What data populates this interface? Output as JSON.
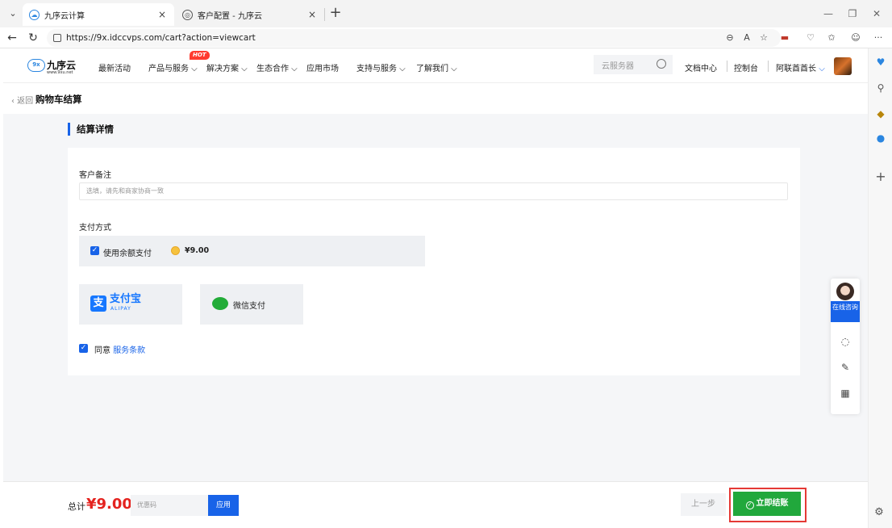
{
  "browser": {
    "tabs": [
      {
        "title": "九序云计算",
        "active": true
      },
      {
        "title": "客户配置 - 九序云",
        "active": false
      }
    ],
    "url": "https://9x.idccvps.com/cart?action=viewcart",
    "new_tab_symbol": "+",
    "close_symbol": "×"
  },
  "site": {
    "logo": {
      "mark": "9x",
      "name": "九序云",
      "sub": "www.9xu.net"
    },
    "nav": [
      {
        "label": "最新活动"
      },
      {
        "label": "产品与服务 ⌵"
      },
      {
        "label": "解决方案 ⌵"
      },
      {
        "label": "生态合作 ⌵"
      },
      {
        "label": "应用市场"
      },
      {
        "label": "支持与服务 ⌵"
      },
      {
        "label": "了解我们 ⌵"
      }
    ],
    "hot_badge": "HOT",
    "search_placeholder": "云服务器",
    "doc_center": "文档中心",
    "console": "控制台",
    "user_name": "阿联酋酋长"
  },
  "crumb": {
    "back": "‹ 返回",
    "title": "购物车结算"
  },
  "section_title": "结算详情",
  "form": {
    "note_label": "客户备注",
    "note_placeholder": "选填，请先和商家协商一致",
    "pay_method_label": "支付方式",
    "use_balance_label": "使用余额支付",
    "balance_amount": "¥9.00",
    "alipay": {
      "glyph": "支",
      "name": "支付宝",
      "sub": "ALIPAY"
    },
    "wechat": {
      "name": "微信支付"
    },
    "agree_text": "同意",
    "terms_text": "服务条款"
  },
  "service_widget": {
    "consult": "在线咨询"
  },
  "footer": {
    "total_label": "总计",
    "total_amount": "¥9.00",
    "coupon_placeholder": "优惠码",
    "apply_button": "应用",
    "prev_button": "上一步",
    "pay_button": "立即结账"
  },
  "colors": {
    "accent_blue": "#1863e8",
    "price_red": "#e4231f",
    "pay_green": "#21a83c",
    "highlight_red": "#e53935"
  },
  "icons": [
    "tab-menu-icon",
    "cloud-favicon-icon",
    "globe-favicon-icon",
    "back-icon",
    "refresh-icon",
    "lock-icon",
    "zoom-icon",
    "read-aloud-icon",
    "favorite-icon",
    "extension-icon",
    "favorites-list-icon",
    "profile-icon",
    "more-icon",
    "search-icon",
    "chevron-down-icon",
    "check-icon",
    "coin-icon",
    "alipay-icon",
    "wechat-icon",
    "chat-icon",
    "edit-icon",
    "qrcode-icon",
    "settings-icon"
  ]
}
